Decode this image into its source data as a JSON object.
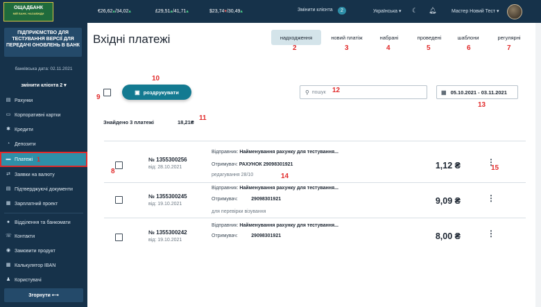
{
  "sidebar": {
    "logo_title": "ОЩАДБАНК",
    "logo_sub": "МІЙ БАНК. НАЗАВЖДИ",
    "company": "ПІДПРИЄМСТВО ДЛЯ ТЕСТУВАННЯ ВЕРСІЇ ДЛЯ ПЕРЕДАЧІ ОНОВЛЕНЬ В БАНК",
    "bank_date": "банківська дата: 02.11.2021",
    "switch_client": "змінити клієнта 2 ▾",
    "items": [
      {
        "label": "Рахунки",
        "icon": "wallet-icon",
        "glyph": "▤"
      },
      {
        "label": "Корпоративні картки",
        "icon": "card-icon",
        "glyph": "▭"
      },
      {
        "label": "Кредити",
        "icon": "credit-icon",
        "glyph": "✱"
      },
      {
        "label": "Депозити",
        "icon": "deposit-icon",
        "glyph": "◔"
      },
      {
        "label": "Платежі",
        "icon": "payment-icon",
        "glyph": "▬"
      },
      {
        "label": "Заявки на валюту",
        "icon": "currency-icon",
        "glyph": "⇄"
      },
      {
        "label": "Підтверджуючі документи",
        "icon": "document-icon",
        "glyph": "▤"
      },
      {
        "label": "Зарплатний проект",
        "icon": "salary-icon",
        "glyph": "▦"
      },
      {
        "label": "Відділення та банкомати",
        "icon": "location-icon",
        "glyph": "●"
      },
      {
        "label": "Контакти",
        "icon": "phone-icon",
        "glyph": "☏"
      },
      {
        "label": "Замовити продукт",
        "icon": "order-icon",
        "glyph": "◉"
      },
      {
        "label": "Калькулятор IBAN",
        "icon": "calculator-icon",
        "glyph": "▦"
      },
      {
        "label": "Користувачі",
        "icon": "users-icon",
        "glyph": "♟"
      }
    ],
    "collapse_label": "Згорнути ⟷"
  },
  "header": {
    "rates": [
      {
        "value": "€26,62",
        "arrow": "▴",
        "value2": "/34,02",
        "arrow2": "▴"
      },
      {
        "value": "£29,51",
        "arrow": "▴",
        "value2": "/41,71",
        "arrow2": "▴"
      },
      {
        "value": "$23,74",
        "arrow": "▾",
        "value2": "/30,49",
        "arrow2": "▴"
      }
    ],
    "change_client": "Змінити клієнта",
    "clients_count": "2",
    "language": "Українська ▾",
    "user_name": "Мастер Новий Тест ▾"
  },
  "page": {
    "title": "Вхідні платежі",
    "tabs": [
      "надходження",
      "новий платіж",
      "набрані",
      "проведені",
      "шаблони",
      "регулярні"
    ],
    "print_label": "роздрукувати",
    "search_placeholder": "пошук",
    "date_range": "05.10.2021 - 03.11.2021",
    "found_text": "Знайдено 3 платежі",
    "found_sum": "18,21₴"
  },
  "annotations": [
    "1",
    "2",
    "3",
    "4",
    "5",
    "6",
    "7",
    "8",
    "9",
    "10",
    "11",
    "12",
    "13",
    "14",
    "15"
  ],
  "payments": [
    {
      "id": "№ 1355300256",
      "date": "від: 28.10.2021",
      "sender_label": "Відправник:",
      "sender": "Найменування рахунку для тестування...",
      "receiver_label": "Отримувач:",
      "receiver": "РАХУНОК 29098301921",
      "note": "редагування 28/10",
      "amount": "1,12 ₴"
    },
    {
      "id": "№ 1355300245",
      "date": "від: 19.10.2021",
      "sender_label": "Відправник:",
      "sender": "Найменування рахунку для тестування...",
      "receiver_label": "Отримувач:",
      "receiver": "29098301921",
      "note": "для перевірки візування",
      "amount": "9,09 ₴"
    },
    {
      "id": "№ 1355300242",
      "date": "від: 19.10.2021",
      "sender_label": "Відправник:",
      "sender": "Найменування рахунку для тестування...",
      "receiver_label": "Отримувач:",
      "receiver": "29098301921",
      "note": "",
      "amount": "8,00 ₴"
    }
  ],
  "colors": {
    "sidebar": "#16324a",
    "accent": "#137a91",
    "active_tab": "#d4e4ea",
    "annotation": "#e12a2a"
  }
}
